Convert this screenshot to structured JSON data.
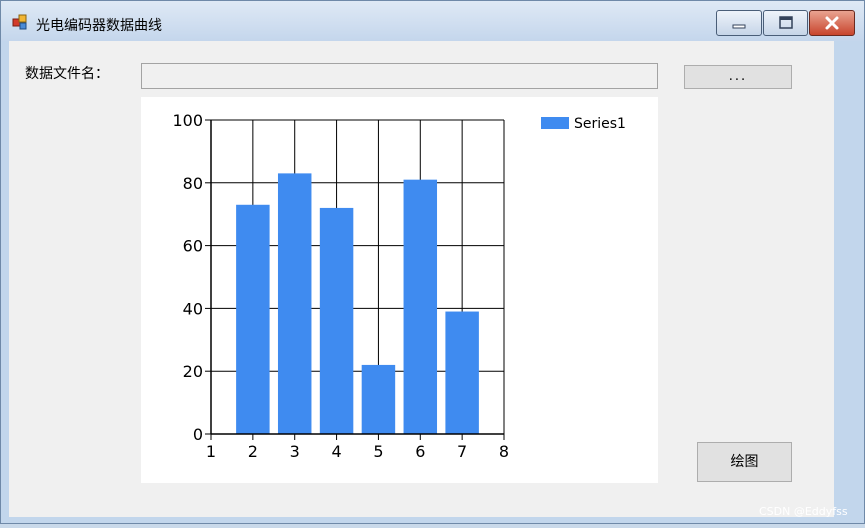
{
  "window": {
    "title": "光电编码器数据曲线",
    "controls": {
      "minimize_icon": "minimize-icon",
      "maximize_icon": "maximize-icon",
      "close_icon": "close-icon"
    }
  },
  "form": {
    "file_label": "数据文件名：",
    "file_path_value": "",
    "browse_label": "...",
    "draw_label": "绘图"
  },
  "chart_data": {
    "type": "bar",
    "categories": [
      2,
      3,
      4,
      5,
      6,
      7
    ],
    "series": [
      {
        "name": "Series1",
        "color": "#3f8bf0",
        "values": [
          73,
          83,
          72,
          22,
          81,
          39
        ]
      }
    ],
    "xlim": [
      1,
      8
    ],
    "ylim": [
      0,
      100
    ],
    "x_ticks": [
      "1",
      "2",
      "3",
      "4",
      "5",
      "6",
      "7",
      "8"
    ],
    "y_ticks": [
      "0",
      "20",
      "40",
      "60",
      "80",
      "100"
    ],
    "grid": true,
    "legend_position": "top-right"
  },
  "watermark": "CSDN @Eddyfss"
}
